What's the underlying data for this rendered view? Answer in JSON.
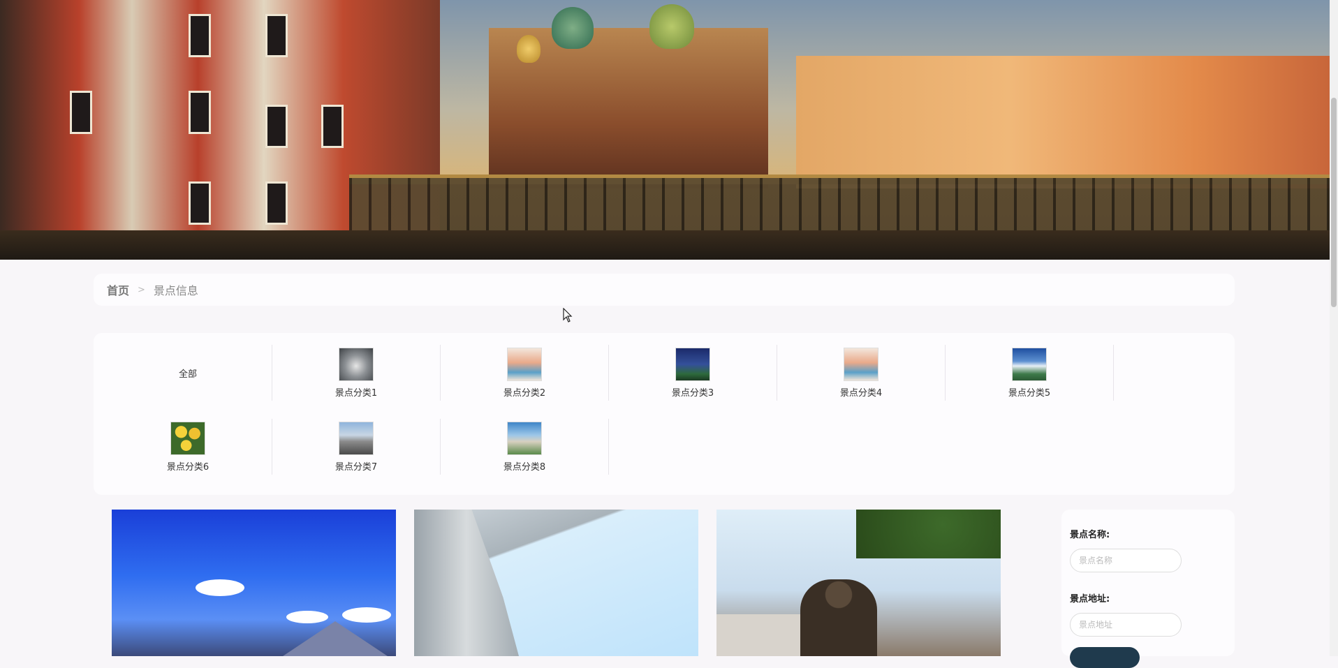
{
  "breadcrumb": {
    "home": "首页",
    "separator": ">",
    "current": "景点信息"
  },
  "categories": [
    {
      "label": "全部",
      "has_image": false
    },
    {
      "label": "景点分类1",
      "has_image": true,
      "color": "#6f7478"
    },
    {
      "label": "景点分类2",
      "has_image": true,
      "color": "#d8a07a"
    },
    {
      "label": "景点分类3",
      "has_image": true,
      "color": "#2c3e7a"
    },
    {
      "label": "景点分类4",
      "has_image": true,
      "color": "#d8a07a"
    },
    {
      "label": "景点分类5",
      "has_image": true,
      "color": "#2f5f9a"
    },
    {
      "label": "景点分类6",
      "has_image": true,
      "color": "#e0b83a"
    },
    {
      "label": "景点分类7",
      "has_image": true,
      "color": "#8aa6c4"
    },
    {
      "label": "景点分类8",
      "has_image": true,
      "color": "#5a8fbf"
    }
  ],
  "search": {
    "name_label": "景点名称:",
    "name_placeholder": "景点名称",
    "address_label": "景点地址:",
    "address_placeholder": "景点地址"
  },
  "colors": {
    "page_bg": "#f8f6f9",
    "panel_bg": "#fdfcfe",
    "button_bg": "#1f3a4d"
  }
}
